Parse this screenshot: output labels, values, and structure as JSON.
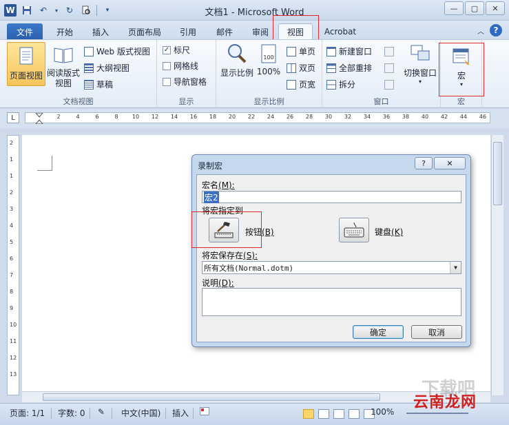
{
  "app": {
    "title": "文档1 - Microsoft Word",
    "logo_letter": "W"
  },
  "window_controls": {
    "minimize": "—",
    "maximize": "▢",
    "close": "✕"
  },
  "tabs": [
    {
      "label": "文件"
    },
    {
      "label": "开始"
    },
    {
      "label": "插入"
    },
    {
      "label": "页面布局"
    },
    {
      "label": "引用"
    },
    {
      "label": "邮件"
    },
    {
      "label": "审阅"
    },
    {
      "label": "视图"
    },
    {
      "label": "Acrobat"
    }
  ],
  "ribbon": {
    "doc_views": {
      "label": "文档视图",
      "print_layout": "页面视图",
      "reading": "阅读版式\n视图",
      "web": "Web 版式视图",
      "outline": "大纲视图",
      "draft": "草稿"
    },
    "show": {
      "label": "显示",
      "ruler": "标尺",
      "gridlines": "网格线",
      "nav_pane": "导航窗格"
    },
    "zoom": {
      "label": "显示比例",
      "zoom": "显示比例",
      "hundred": "100%",
      "one_page": "单页",
      "two_pages": "双页",
      "page_width": "页宽"
    },
    "window": {
      "label": "窗口",
      "new_window": "新建窗口",
      "arrange_all": "全部重排",
      "split": "拆分",
      "switch": "切换窗口"
    },
    "macros": {
      "label": "宏",
      "button": "宏"
    }
  },
  "ruler": {
    "corner": "L",
    "marks": [
      "2",
      "4",
      "6",
      "8",
      "10",
      "12",
      "14",
      "16",
      "18",
      "20",
      "22",
      "24",
      "26",
      "28",
      "30",
      "32",
      "34",
      "36",
      "38",
      "40",
      "42",
      "44",
      "46"
    ],
    "vmarks": [
      "2",
      "1",
      "1",
      "2",
      "3",
      "4",
      "5",
      "6",
      "7",
      "8",
      "9",
      "10",
      "11",
      "12",
      "13"
    ]
  },
  "dialog": {
    "title": "录制宏",
    "help": "?",
    "close": "✕",
    "macro_name_label": "宏名",
    "macro_name_key": "(M):",
    "macro_name_value": "宏2",
    "assign_label": "将宏指定到",
    "button_label": "按钮",
    "button_key": "(B)",
    "keyboard_label": "键盘",
    "keyboard_key": "(K)",
    "store_label": "将宏保存在",
    "store_key": "(S):",
    "store_value": "所有文档(Normal.dotm)",
    "desc_label": "说明",
    "desc_key": "(D):",
    "desc_value": "",
    "ok": "确定",
    "cancel": "取消"
  },
  "status": {
    "page": "页面: 1/1",
    "words": "字数: 0",
    "language": "中文(中国)",
    "insert": "插入",
    "zoom": "100%"
  },
  "watermark": {
    "text": "云南龙网",
    "faded": "下载吧"
  },
  "colors": {
    "accent": "#2a5fae",
    "highlight": "#e0262b",
    "dialog_bg": "#c6d8ee"
  }
}
